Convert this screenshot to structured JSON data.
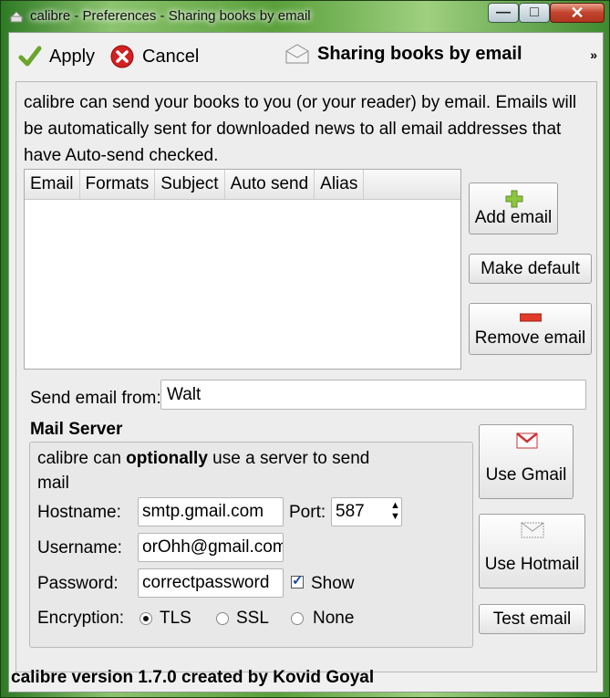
{
  "window": {
    "title": "calibre - Preferences - Sharing books by email"
  },
  "toolbar": {
    "apply_label": "Apply",
    "cancel_label": "Cancel",
    "section_title": "Sharing books by email",
    "more": "»"
  },
  "intro_text": "calibre can send your books to you (or your reader) by email. Emails will be automatically sent for downloaded news to all email addresses that have Auto-send checked.",
  "email_table": {
    "columns": [
      "Email",
      "Formats",
      "Subject",
      "Auto send",
      "Alias"
    ],
    "rows": []
  },
  "buttons": {
    "add_email": "Add email",
    "make_default": "Make default",
    "remove_email": "Remove email",
    "use_gmail": "Use Gmail",
    "use_hotmail": "Use Hotmail",
    "test_email": "Test email"
  },
  "send_from": {
    "label": "Send email from:",
    "value": "Walt"
  },
  "mail_server": {
    "title": "Mail Server",
    "desc_pre": "calibre can ",
    "desc_bold": "optionally",
    "desc_post": " use a server to send mail",
    "hostname_label": "Hostname:",
    "hostname": "smtp.gmail.com",
    "port_label": "Port:",
    "port": "587",
    "username_label": "Username:",
    "username": "orOhh@gmail.com",
    "password_label": "Password:",
    "password": "correctpassword",
    "show_label": "Show",
    "show_checked": true,
    "encryption_label": "Encryption:",
    "encryption_options": [
      "TLS",
      "SSL",
      "None"
    ],
    "encryption_selected": "TLS"
  },
  "footer": "calibre version 1.7.0 created by Kovid Goyal"
}
